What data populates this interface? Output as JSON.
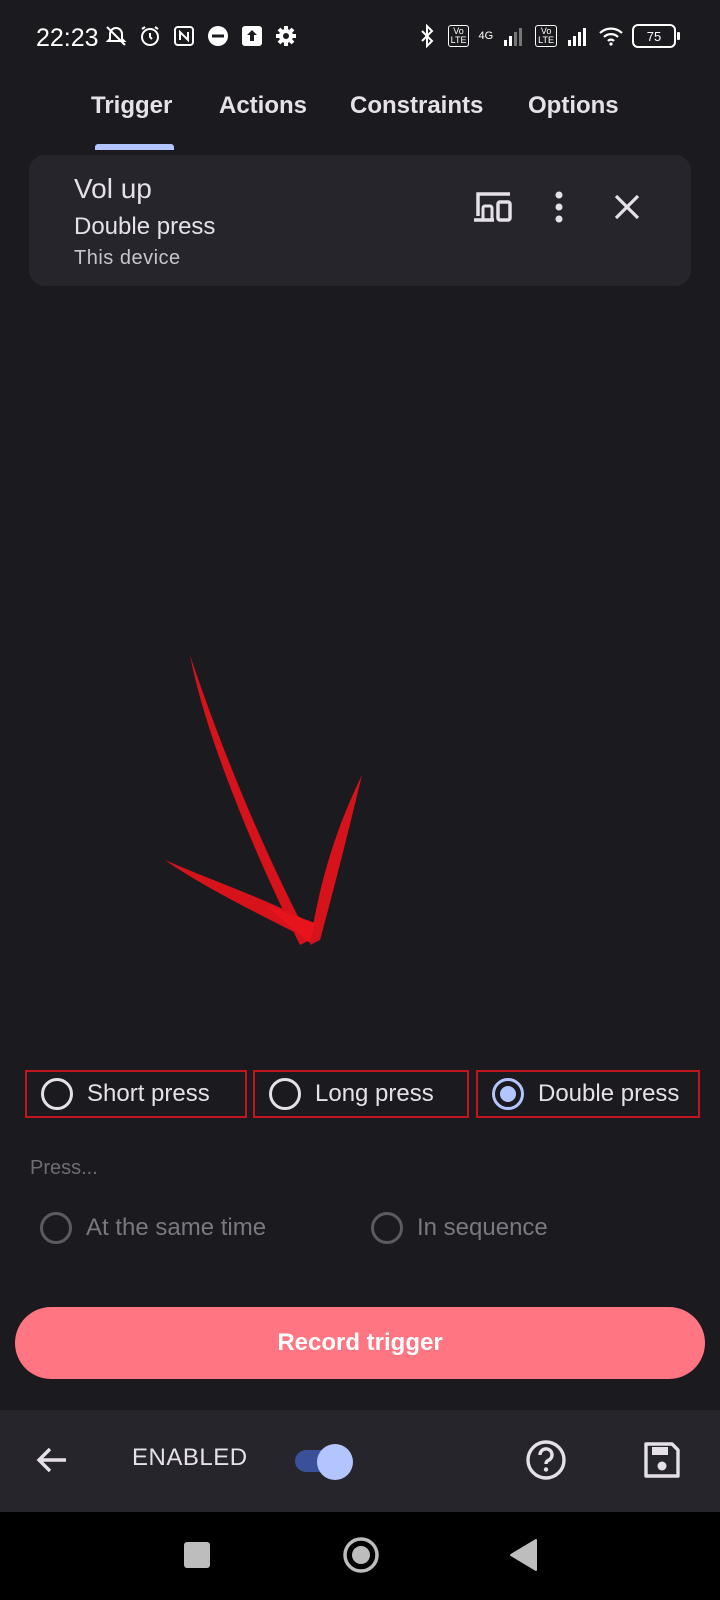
{
  "status_bar": {
    "time": "22:23",
    "network_type": "4G",
    "volte_label": "Vo\nLTE",
    "battery_level": "75"
  },
  "tabs": [
    {
      "label": "Trigger",
      "selected": true
    },
    {
      "label": "Actions",
      "selected": false
    },
    {
      "label": "Constraints",
      "selected": false
    },
    {
      "label": "Options",
      "selected": false
    }
  ],
  "trigger_card": {
    "title": "Vol up",
    "press_type": "Double press",
    "device": "This device",
    "icons": [
      "devices-icon",
      "more-vert-icon",
      "close-icon"
    ]
  },
  "press_options": [
    {
      "label": "Short press",
      "selected": false
    },
    {
      "label": "Long press",
      "selected": false
    },
    {
      "label": "Double press",
      "selected": true
    }
  ],
  "press_mode": {
    "heading": "Press...",
    "options": [
      {
        "label": "At the same time",
        "enabled": false
      },
      {
        "label": "In sequence",
        "enabled": false
      }
    ]
  },
  "record_button": {
    "label": "Record trigger",
    "color": "#ff7682"
  },
  "bottom_bar": {
    "enabled_label": "ENABLED",
    "toggle_on": true
  },
  "colors": {
    "background": "#1b1a1f",
    "surface": "#25252b",
    "accent": "#b3c5ff",
    "annotation": "#c0161c"
  }
}
